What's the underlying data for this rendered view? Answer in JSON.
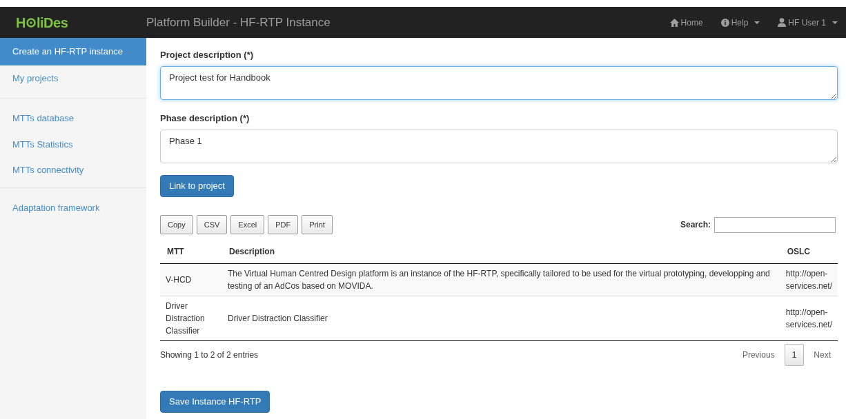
{
  "navbar": {
    "logo": {
      "before": "H",
      "after": "liDes"
    },
    "title": "Platform Builder - HF-RTP Instance",
    "links": [
      {
        "kind": "home",
        "label": "Home",
        "dropdown": false
      },
      {
        "kind": "info",
        "label": "Help",
        "dropdown": true
      },
      {
        "kind": "user",
        "label": "HF User 1",
        "dropdown": true
      }
    ]
  },
  "sidebar": {
    "groups": [
      [
        {
          "label": "Create an HF-RTP instance",
          "selected": true
        },
        {
          "label": "My projects",
          "selected": false
        }
      ],
      [
        {
          "label": "MTTs database",
          "selected": false
        },
        {
          "label": "MTTs Statistics",
          "selected": false
        },
        {
          "label": "MTTs connectivity",
          "selected": false
        }
      ],
      [
        {
          "label": "Adaptation framework",
          "selected": false
        }
      ]
    ]
  },
  "form": {
    "fields": [
      {
        "label": "Project description (*)",
        "value": "Project test for Handbook",
        "focused": true
      },
      {
        "label": "Phase description (*)",
        "value": "Phase 1",
        "focused": false
      }
    ],
    "link_button": "Link to project"
  },
  "table": {
    "export_buttons": [
      "Copy",
      "CSV",
      "Excel",
      "PDF",
      "Print"
    ],
    "search_label": "Search:",
    "columns": [
      "MTT",
      "Description",
      "OSLC"
    ],
    "rows": [
      [
        "V-HCD",
        "The Virtual Human Centred Design platform is an instance of the HF-RTP, specifically tailored to be used for the virtual prototyping, developping and testing of an AdCos based on MOVIDA.",
        "http://open-services.net/"
      ],
      [
        "Driver Distraction Classifier",
        "Driver Distraction Classifier",
        "http://open-services.net/"
      ]
    ],
    "info": "Showing 1 to 2 of 2 entries",
    "pagination": {
      "previous": "Previous",
      "pages": [
        {
          "label": "1",
          "selected": true
        }
      ],
      "next": "Next"
    }
  },
  "save_button": "Save Instance HF-RTP"
}
